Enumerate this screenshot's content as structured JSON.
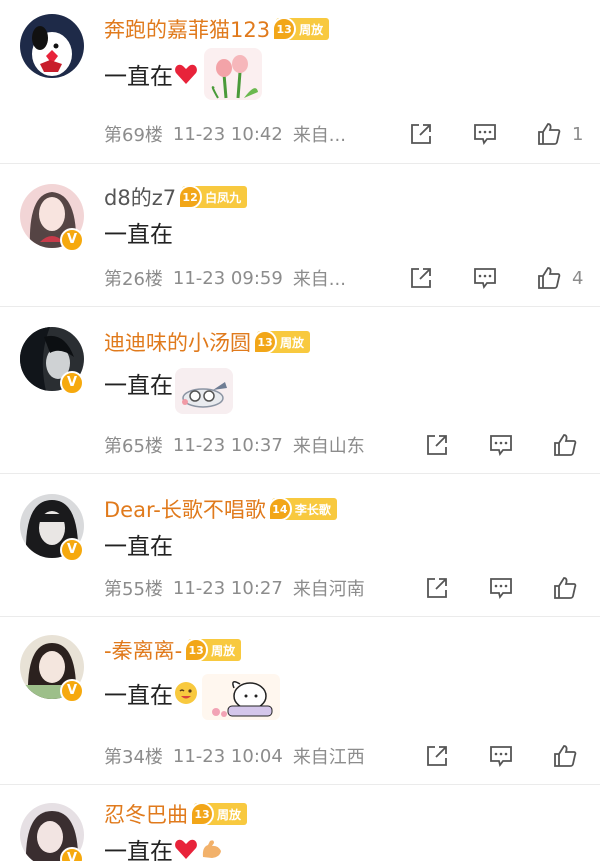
{
  "comments": [
    {
      "username": "奔跑的嘉菲猫123",
      "fan_level": "13",
      "fan_name": "周放",
      "content": "一直在",
      "emoji": [
        "heart-icon",
        "tulip-sticker"
      ],
      "floor": "第69楼",
      "time": "11-23 10:42",
      "location": "来自...",
      "likes": "1",
      "verified": false
    },
    {
      "username": "d8的z7",
      "fan_level": "12",
      "fan_name": "白凤九",
      "content": "一直在",
      "emoji": [],
      "floor": "第26楼",
      "time": "11-23 09:59",
      "location": "来自...",
      "likes": "4",
      "verified": true
    },
    {
      "username": "迪迪味的小汤圆",
      "fan_level": "13",
      "fan_name": "周放",
      "content": "一直在",
      "emoji": [
        "plane-sticker"
      ],
      "floor": "第65楼",
      "time": "11-23 10:37",
      "location": "来自山东",
      "likes": "",
      "verified": true
    },
    {
      "username": "Dear-长歌不唱歌",
      "fan_level": "14",
      "fan_name": "李长歌",
      "content": "一直在",
      "emoji": [],
      "floor": "第55楼",
      "time": "11-23 10:27",
      "location": "来自河南",
      "likes": "",
      "verified": true
    },
    {
      "username": "-秦离离-",
      "fan_level": "13",
      "fan_name": "周放",
      "content": "一直在",
      "emoji": [
        "wink-face-icon",
        "dog-sticker"
      ],
      "floor": "第34楼",
      "time": "11-23 10:04",
      "location": "来自江西",
      "likes": "",
      "verified": true
    },
    {
      "username": "忍冬巴曲",
      "fan_level": "13",
      "fan_name": "周放",
      "content": "一直在",
      "emoji": [
        "heart-icon",
        "flex-arm-icon"
      ],
      "floor": "",
      "time": "",
      "location": "",
      "likes": "",
      "verified": true
    }
  ],
  "colors": {
    "username": "#e07a1c",
    "fan_badge": "#f8c93f",
    "meta": "#8c8c8c",
    "heart": "#e8233a"
  },
  "icons": {
    "verified": "V"
  }
}
